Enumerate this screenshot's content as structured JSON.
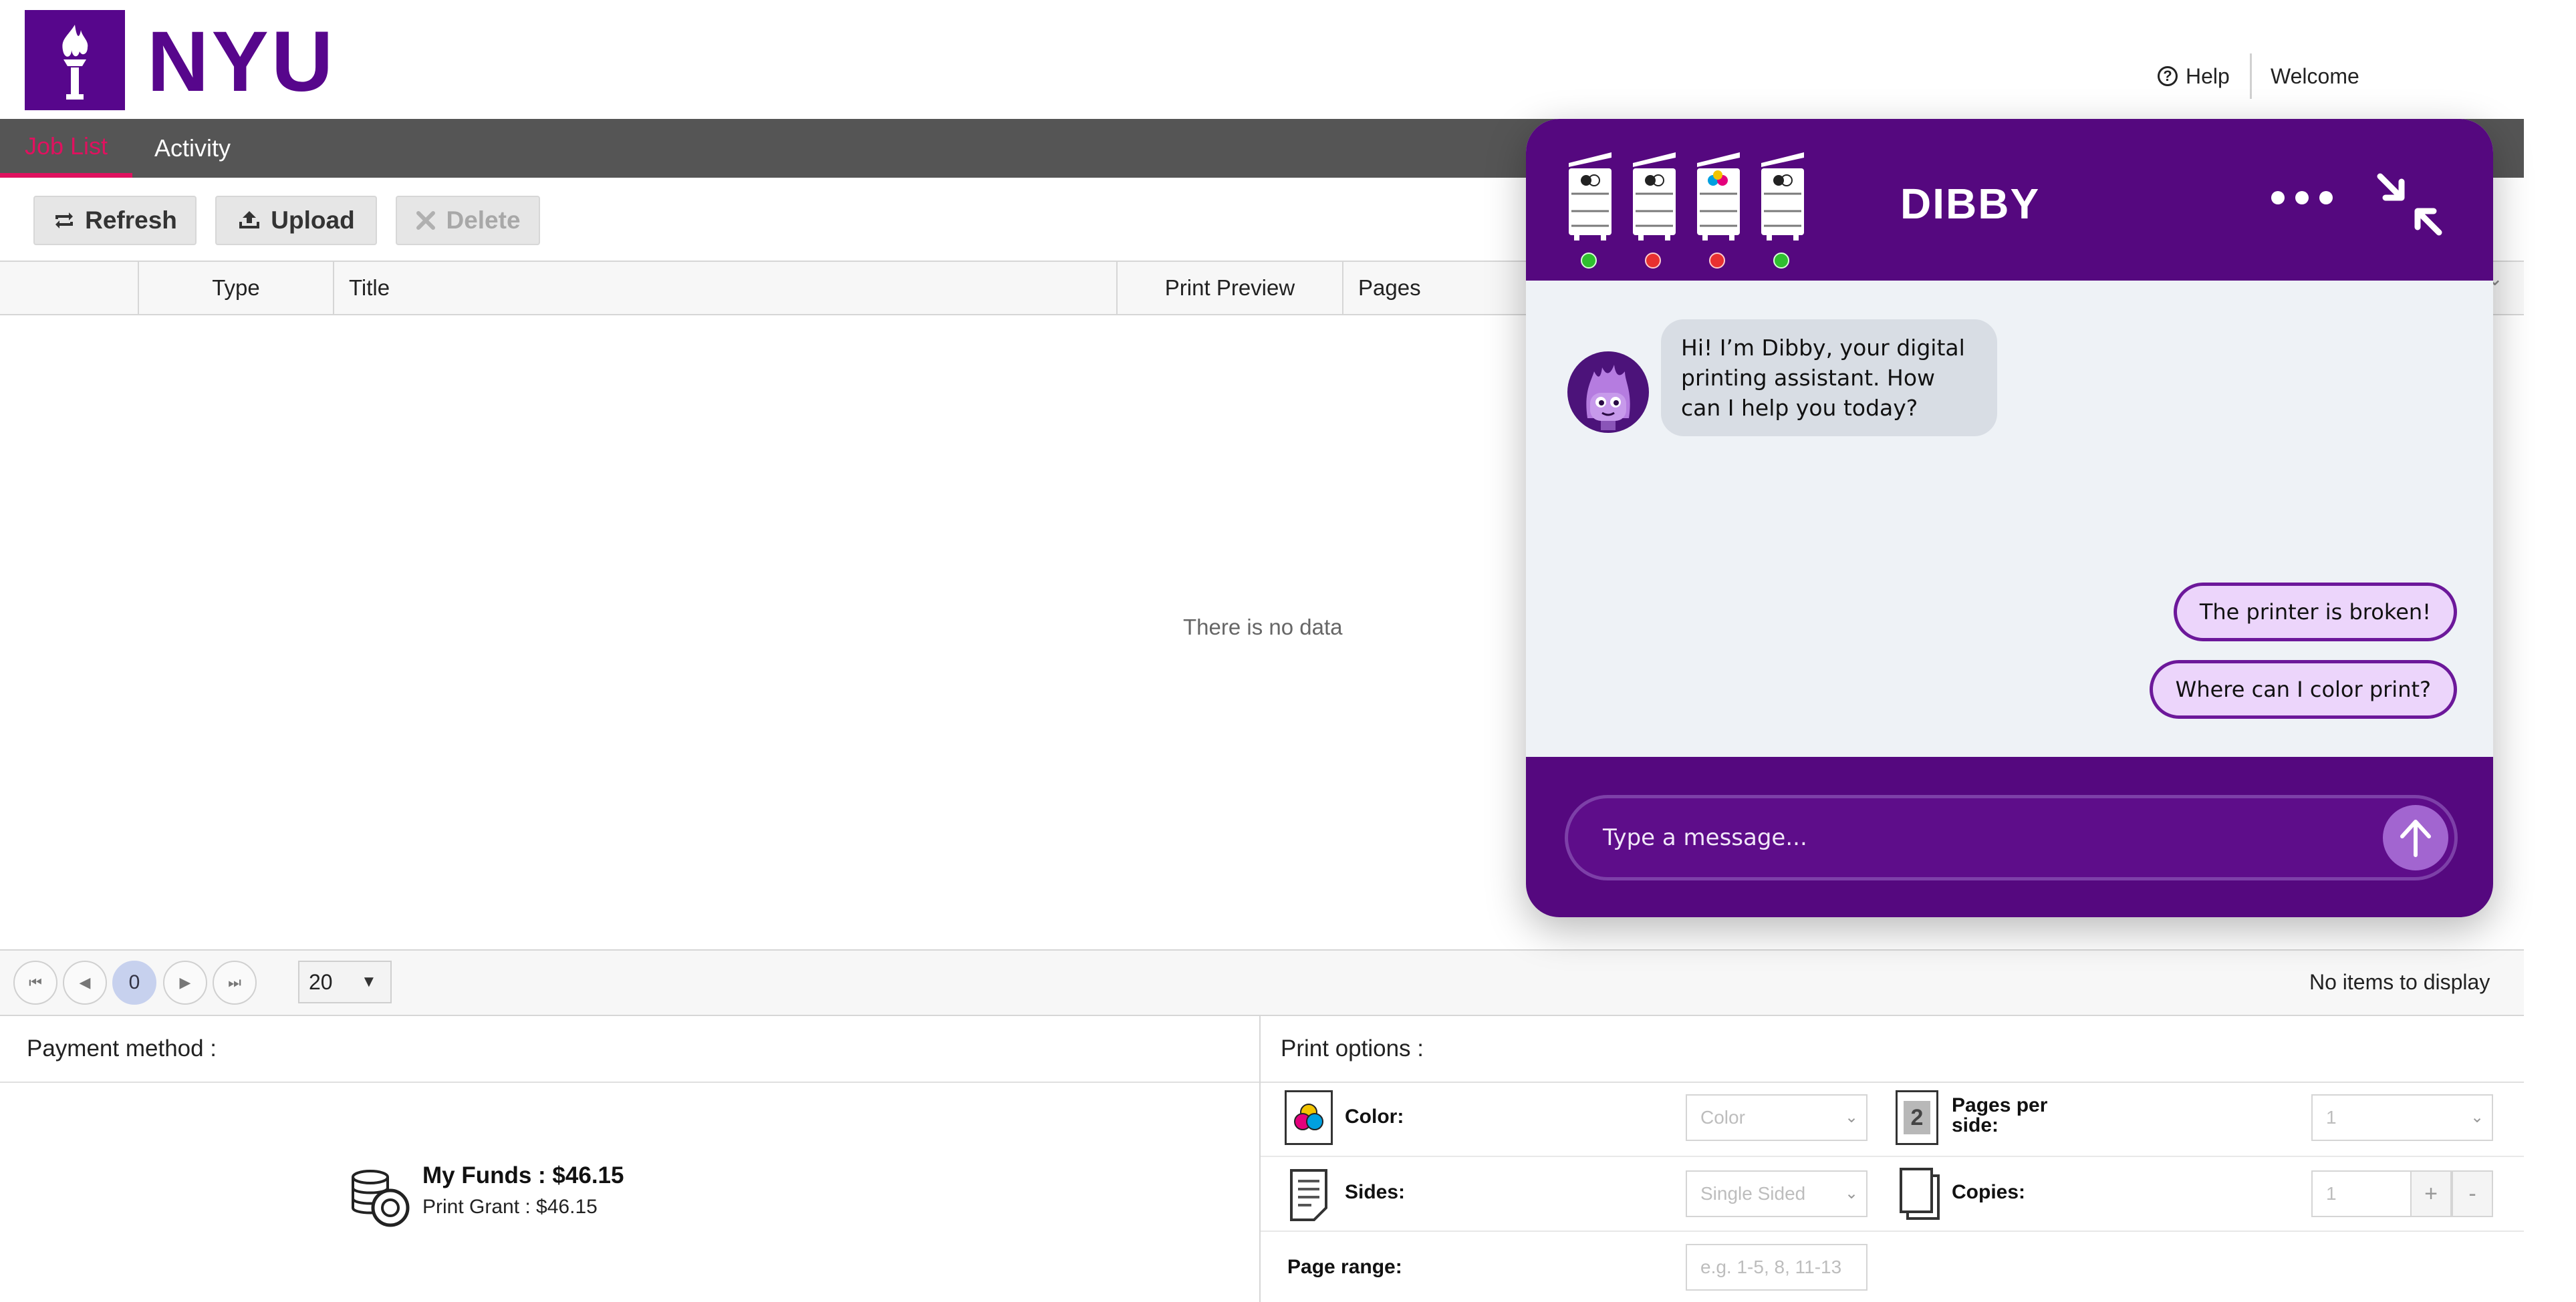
{
  "brand": {
    "logo_text": "NYU",
    "accent": "#57068c"
  },
  "header": {
    "help_label": "Help",
    "welcome_label": "Welcome"
  },
  "nav": {
    "tabs": [
      {
        "label": "Job List",
        "active": true
      },
      {
        "label": "Activity",
        "active": false
      }
    ]
  },
  "toolbar": {
    "refresh_label": "Refresh",
    "upload_label": "Upload",
    "delete_label": "Delete"
  },
  "grid": {
    "columns": [
      "Type",
      "Title",
      "Print Preview",
      "Pages"
    ],
    "empty_message": "There is no data"
  },
  "pager": {
    "current_page": "0",
    "page_size": "20",
    "status": "No items to display"
  },
  "payment": {
    "header": "Payment method :",
    "funds": "My Funds : $46.15",
    "grant": "Print Grant : $46.15"
  },
  "print_options": {
    "header": "Print options :",
    "color_label": "Color:",
    "color_value": "Color",
    "pages_per_side_label": "Pages per side:",
    "pages_per_side_value": "1",
    "sides_label": "Sides:",
    "sides_value": "Single Sided",
    "copies_label": "Copies:",
    "copies_value": "1",
    "plus": "+",
    "minus": "-",
    "page_range_label": "Page range:",
    "page_range_placeholder": "e.g. 1-5, 8, 11-13"
  },
  "chat": {
    "title": "DIBBY",
    "printers": [
      {
        "status": "ok"
      },
      {
        "status": "error"
      },
      {
        "status": "error"
      },
      {
        "status": "ok"
      }
    ],
    "bot_message": "Hi! I’m Dibby, your digital printing assistant. How can I help you today?",
    "quick_replies": [
      "The printer is broken!",
      "Where can I color print?"
    ],
    "input_placeholder": "Type a message..."
  },
  "colors": {
    "chat_purple": "#55087f",
    "tab_active": "#e0115f",
    "nav_bg": "#555555"
  }
}
